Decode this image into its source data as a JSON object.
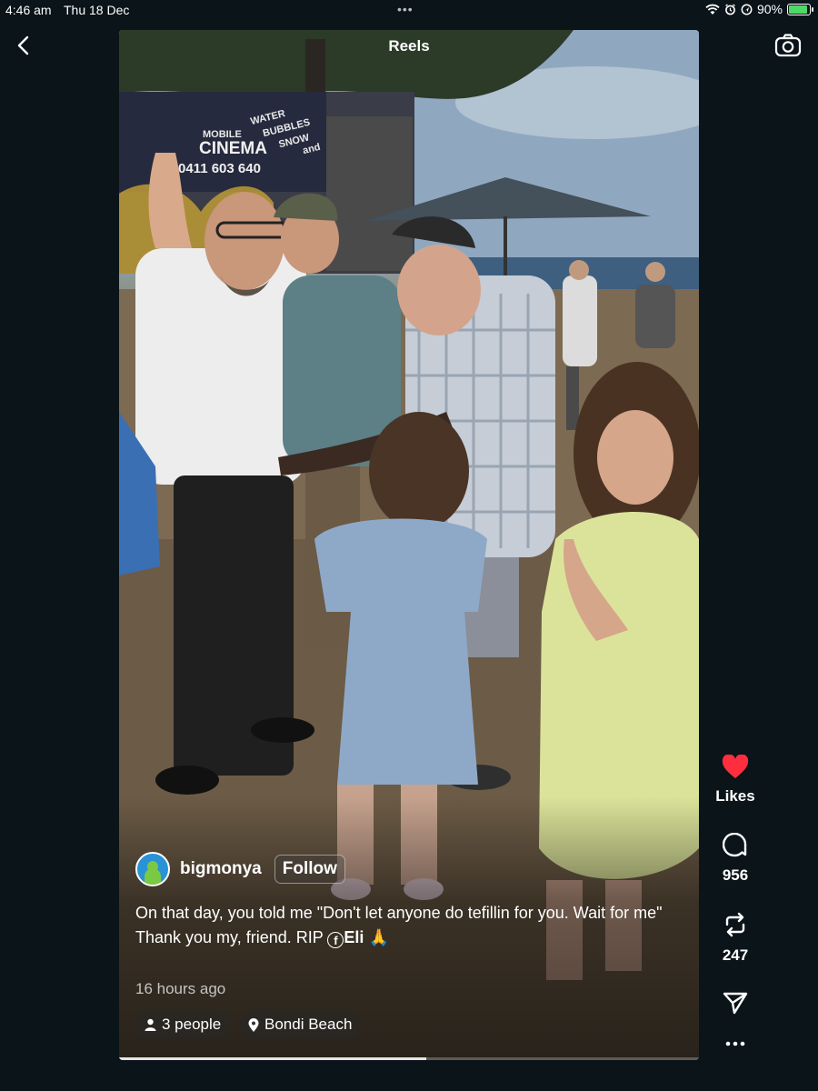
{
  "status_bar": {
    "time": "4:46 am",
    "date": "Thu 18 Dec",
    "battery_percent": 90,
    "battery_label": "90%",
    "icons": [
      "wifi-icon",
      "alarm-icon",
      "location-icon",
      "battery-charging-icon"
    ],
    "battery_color": "#4cd964"
  },
  "nav": {
    "back_icon": "chevron-left-icon",
    "camera_icon": "camera-icon"
  },
  "reel": {
    "title": "Reels",
    "author": {
      "username": "bigmonya",
      "follow_label": "Follow"
    },
    "caption_line1": "On that day, you told me \"Don't let anyone do tefillin for you. Wait for me\"",
    "caption_line2_prefix": "Thank you my, friend. RIP ",
    "caption_fb_glyph": "f",
    "caption_tagged": "Eli",
    "caption_emoji": "🙏",
    "timestamp": "16 hours ago",
    "tags": {
      "people": "3 people",
      "location": "Bondi Beach"
    },
    "playback_progress": 0.53,
    "scene_signage": {
      "brand_top": "MOBILE",
      "brand": "CINEMA",
      "phone": "0411 603 640",
      "side_lines": [
        "WATER",
        "BUBBLES",
        "SNOW",
        "and"
      ]
    }
  },
  "actions": {
    "likes_label": "Likes",
    "comments_count": "956",
    "reposts_count": "247",
    "like_color": "#ff2e3f",
    "icons": [
      "heart-icon",
      "comment-icon",
      "repost-icon",
      "share-icon",
      "more-icon"
    ]
  }
}
